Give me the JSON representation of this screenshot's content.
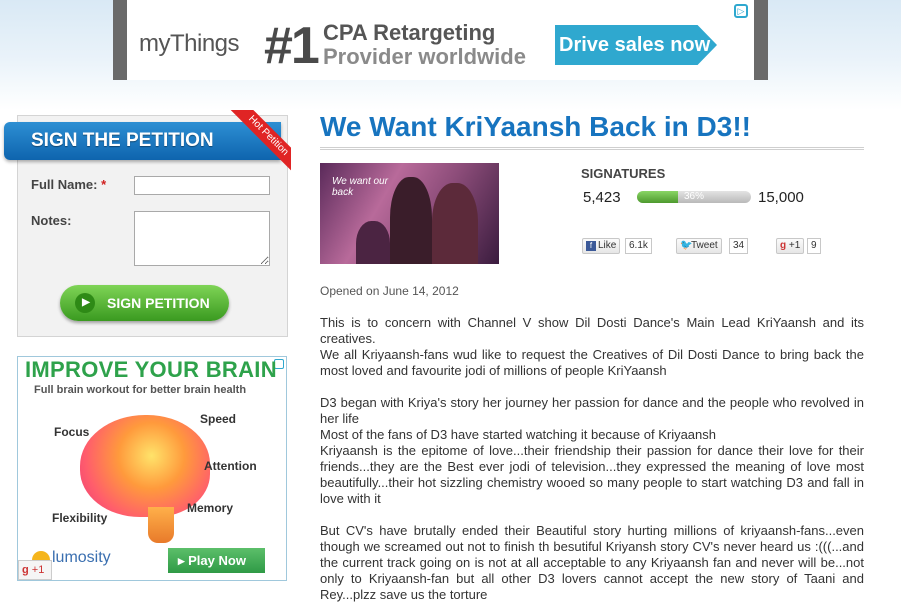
{
  "top_ad": {
    "brand": "myThings",
    "number": "#1",
    "line1": "CPA Retargeting",
    "line2": "Provider worldwide",
    "cta": "Drive sales now",
    "choice_icon": "adchoices-icon"
  },
  "petition_form": {
    "header": "SIGN THE PETITION",
    "ribbon": "Hot Petition",
    "full_name_label": "Full Name:",
    "required_mark": "*",
    "full_name_value": "",
    "notes_label": "Notes:",
    "notes_value": "",
    "submit_label": "SIGN PETITION",
    "submit_icon": "play-arrow-icon"
  },
  "side_ad": {
    "title": "IMPROVE YOUR BRAIN",
    "subtitle": "Full brain workout for better brain health",
    "words": [
      "Focus",
      "Speed",
      "Attention",
      "Memory",
      "Flexibility"
    ],
    "brand": "lumosity",
    "cta": "Play Now",
    "gplus": "+1"
  },
  "petition": {
    "title": "We Want KriYaansh Back in D3!!",
    "image_caption": "We want our\nback",
    "signatures_label": "SIGNATURES",
    "signatures_current": "5,423",
    "signatures_goal": "15,000",
    "progress_percent_label": "36%",
    "progress_fraction": 0.36,
    "share": {
      "like_label": "Like",
      "like_count": "6.1k",
      "tweet_label": "Tweet",
      "tweet_count": "34",
      "gplus_label": "+1",
      "gplus_count": "9"
    },
    "opened": "Opened on June 14, 2012",
    "paragraphs": [
      "This is to concern with Channel V show Dil Dosti Dance's Main Lead KriYaansh and its creatives.\nWe all Kriyaansh-fans wud like to request the Creatives of Dil Dosti Dance to bring back the most loved and favourite jodi of millions of people KriYaansh",
      "D3 began with Kriya's story her journey her passion for dance and the people who revolved in her life\nMost of the fans of D3 have started watching it because of Kriyaansh\nKriyaansh is the epitome of love...their friendship their passion for dance their love for their friends...they are the Best ever jodi of television...they expressed the meaning of love most beautifully...their hot sizzling chemistry wooed so many people to start watching D3 and fall in love with it",
      "But CV's have brutally ended their Beautiful story hurting millions of kriyaansh-fans...even though we screamed out not to finish th besutiful Kriyansh story CV's never heard us :(((...and the current track going on is not at all acceptable to any Kriyaansh fan and never will be...not only to Kriyaansh-fan but all other D3 lovers cannot accept the new story of Taani and Rey...plzz save us the torture"
    ]
  },
  "colors": {
    "title_blue": "#1774bf",
    "header_blue": "#0e64ae",
    "button_green": "#3a9a20",
    "ribbon_red": "#e02424",
    "brain_green": "#2ea24b"
  }
}
